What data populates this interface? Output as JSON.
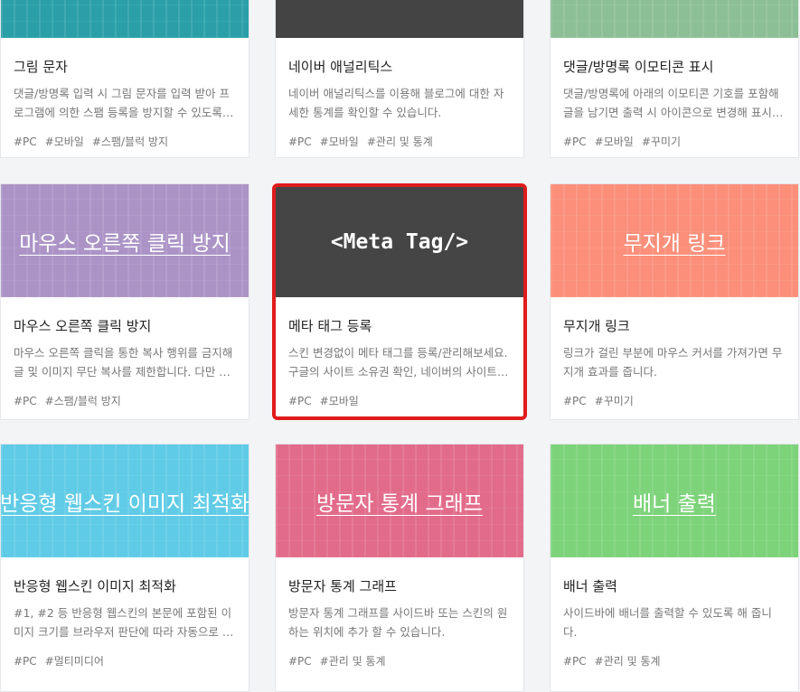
{
  "cards": [
    {
      "thumb_text": "",
      "thumb_color": "#2a9fa8",
      "title": "그림 문자",
      "desc": "댓글/방명록 입력 시 그림 문자를 입력 받아 프로그램에 의한 스팸 등록을 방지할 수 있도록 합니다.",
      "tags": [
        "#PC",
        "#모바일",
        "#스팸/블럭 방지"
      ]
    },
    {
      "thumb_text": "",
      "thumb_color": "#444444",
      "title": "네이버 애널리틱스",
      "desc": "네이버 애널리틱스를 이용해 블로그에 대한 자세한 통계를 확인할 수 있습니다.",
      "tags": [
        "#PC",
        "#모바일",
        "#관리 및 통계"
      ]
    },
    {
      "thumb_text": "",
      "thumb_color": "#8dbf96",
      "title": "댓글/방명록 이모티콘 표시",
      "desc": "댓글/방명록에 아래의 이모티콘 기호를 포함해 글을 남기면 출력 시 아이콘으로 변경해 표시합니다.",
      "tags": [
        "#PC",
        "#모바일",
        "#꾸미기"
      ]
    },
    {
      "thumb_text": "마우스 오른쪽 클릭 방지",
      "thumb_color": "#ab93c6",
      "title": "마우스 오른쪽 클릭 방지",
      "desc": "마우스 오른쪽 클릭을 통한 복사 행위를 금지해 글 및 이미지 무단 복사를 제한합니다. 다만 일부 환경에서는",
      "tags": [
        "#PC",
        "#스팸/블럭 방지"
      ]
    },
    {
      "thumb_text": "<Meta Tag/>",
      "thumb_color": "#454545",
      "title": "메타 태그 등록",
      "desc": "스킨 변경없이 메타 태그를 등록/관리해보세요. 구글의 사이트 소유권 확인, 네이버의 사이트 등록 등",
      "tags": [
        "#PC",
        "#모바일"
      ]
    },
    {
      "thumb_text": "무지개 링크",
      "thumb_color": "#fb8f7a",
      "title": "무지개 링크",
      "desc": "링크가 걸린 부분에 마우스 커서를 가져가면 무지개 효과를 줍니다.",
      "tags": [
        "#PC",
        "#꾸미기"
      ]
    },
    {
      "thumb_text": "반응형 웹스킨 이미지 최적화",
      "thumb_color": "#5fcbe6",
      "title": "반응형 웹스킨 이미지 최적화",
      "desc": "#1, #2 등 반응형 웹스킨의 본문에 포함된 이미지 크기를 브라우저 판단에 따라 자동으로 조절합니다.",
      "tags": [
        "#PC",
        "#멀티미디어"
      ]
    },
    {
      "thumb_text": "방문자 통계 그래프",
      "thumb_color": "#e26b8a",
      "title": "방문자 통계 그래프",
      "desc": "방문자 통계 그래프를 사이드바 또는 스킨의 원하는 위치에 추가 할 수 있습니다.",
      "tags": [
        "#PC",
        "#관리 및 통계"
      ]
    },
    {
      "thumb_text": "배너 출력",
      "thumb_color": "#7dd37a",
      "title": "배너 출력",
      "desc": "사이드바에 배너를 출력할 수 있도록 해 줍니다.",
      "tags": [
        "#PC",
        "#관리 및 통계"
      ]
    }
  ]
}
